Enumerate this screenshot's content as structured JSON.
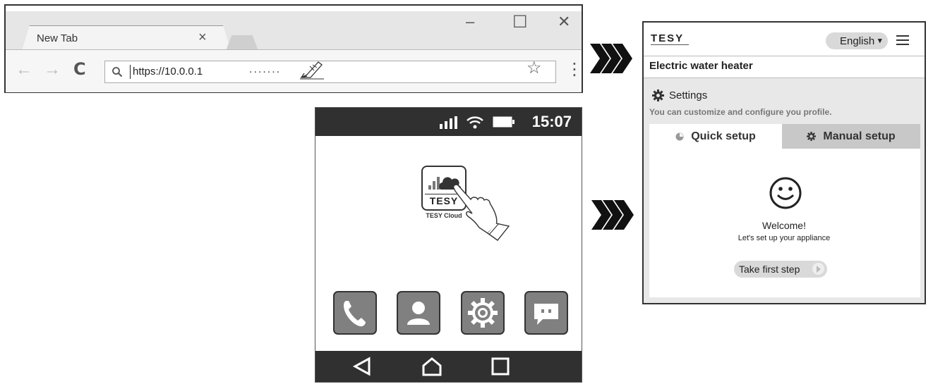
{
  "browser": {
    "tab_title": "New Tab",
    "tab_close": "×",
    "minimize": "–",
    "maximize": "☐",
    "close": "✕",
    "back": "←",
    "forward": "→",
    "reload": "C",
    "url": "https://10.0.0.1",
    "dots": ".......",
    "star": "☆",
    "menu": "⋮"
  },
  "arrows": {
    "top": "»»»",
    "bottom": "»»»"
  },
  "phone": {
    "time": "15:07",
    "app_brand": "TESY",
    "app_label": "TESY Cloud"
  },
  "webpage": {
    "logo": "TESY",
    "language": "English",
    "title": "Electric water heater",
    "settings_label": "Settings",
    "settings_desc": "You can customize and configure you profile.",
    "tab_quick": "Quick setup",
    "tab_manual": "Manual setup",
    "welcome": "Welcome!",
    "welcome_sub": "Let's set up your appliance",
    "cta": "Take first step"
  },
  "colors": {
    "dark_bar": "#303030",
    "tab_active": "#c8c8c8",
    "app_tile": "#808080"
  }
}
